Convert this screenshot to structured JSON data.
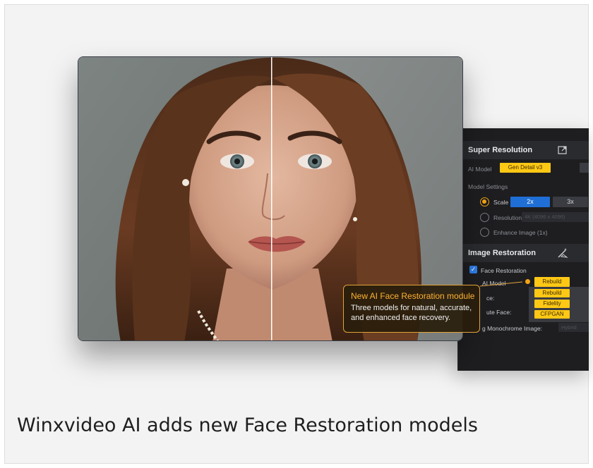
{
  "panel": {
    "super_resolution": {
      "title": "Super Resolution",
      "ai_model_label": "AI Model",
      "ai_model_value": "Gen Detail v3",
      "model_settings_label": "Model Settings",
      "scale_label": "Scale",
      "scale_options": [
        "2x",
        "3x"
      ],
      "resolution_label": "Resolution",
      "resolution_placeholder": "4K (4096 x 4096)",
      "enhance_label": "Enhance Image (1x)"
    },
    "image_restoration": {
      "title": "Image Restoration",
      "face_restoration_label": "Face Restoration",
      "ai_model_label": "AI Model",
      "ai_model_value": "Rebuild",
      "options": [
        "Rebuild",
        "Fidelity",
        "CFPGAN"
      ],
      "partial_label_1": "ce:",
      "partial_label_2": "ute Face:",
      "monochrome_label": "g Monochrome Image:",
      "monochrome_value": "Hybrid"
    }
  },
  "callout": {
    "title": "New AI Face Restoration module",
    "body": "Three models for natural, accurate, and enhanced face recovery."
  },
  "caption": "Winxvideo AI adds new Face Restoration models"
}
